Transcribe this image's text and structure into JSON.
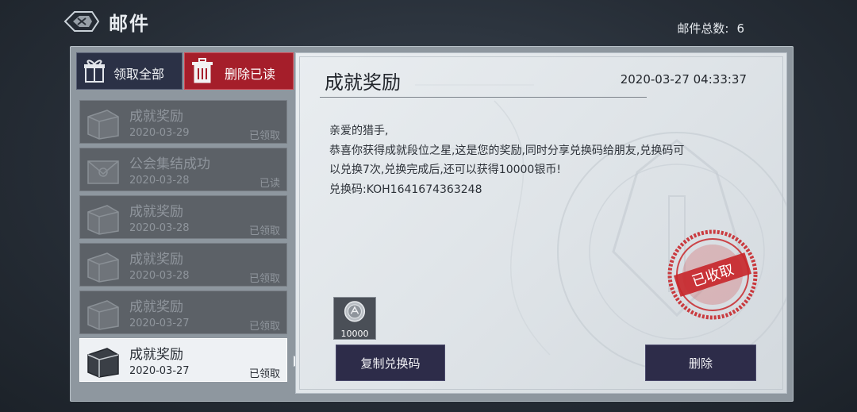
{
  "header": {
    "title": "邮件",
    "mail_count_label": "邮件总数:",
    "mail_count_value": "6"
  },
  "actions": {
    "collect_all": "领取全部",
    "delete_read": "删除已读"
  },
  "mail_list": [
    {
      "title": "成就奖励",
      "date": "2020-03-29",
      "status": "已领取",
      "icon": "box-icon",
      "selected": false
    },
    {
      "title": "公会集结成功",
      "date": "2020-03-28",
      "status": "已读",
      "icon": "envelope-icon",
      "selected": false
    },
    {
      "title": "成就奖励",
      "date": "2020-03-28",
      "status": "已领取",
      "icon": "box-icon",
      "selected": false
    },
    {
      "title": "成就奖励",
      "date": "2020-03-28",
      "status": "已领取",
      "icon": "box-icon",
      "selected": false
    },
    {
      "title": "成就奖励",
      "date": "2020-03-27",
      "status": "已领取",
      "icon": "box-icon",
      "selected": false
    },
    {
      "title": "成就奖励",
      "date": "2020-03-27",
      "status": "已领取",
      "icon": "box-icon",
      "selected": true
    }
  ],
  "detail": {
    "title": "成就奖励",
    "timestamp": "2020-03-27 04:33:37",
    "body_lines": [
      "亲爱的猎手,",
      "恭喜你获得成就段位之星,这是您的奖励,同时分享兑换码给朋友,兑换码可",
      "以兑换7次,兑换完成后,还可以获得10000银币!",
      "兑换码:KOH1641674363248"
    ],
    "reward": {
      "icon": "silver-coin-icon",
      "quantity": "10000"
    },
    "stamp_text": "已收取",
    "copy_button": "复制兑换码",
    "delete_button": "删除"
  },
  "colors": {
    "accent_red": "#a51e2a",
    "button_dark": "#2d2c49",
    "stamp_red": "#c8282c"
  }
}
